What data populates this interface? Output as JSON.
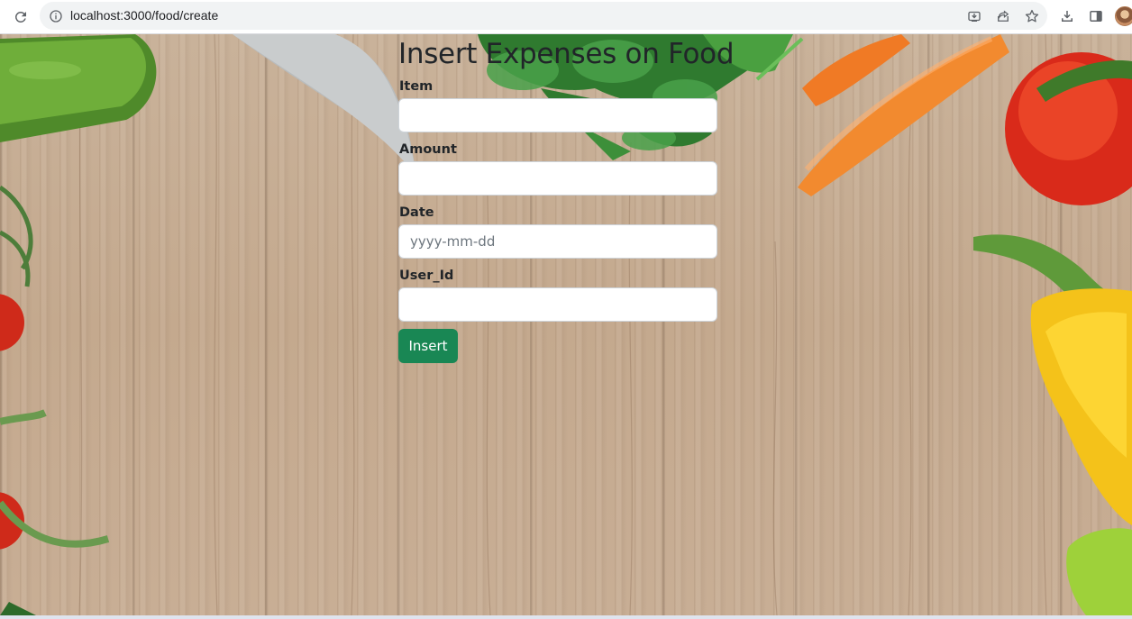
{
  "browser": {
    "url": "localhost:3000/food/create",
    "icons": {
      "reload": "reload-icon",
      "site_info": "info-icon",
      "install": "install-icon",
      "share": "share-icon",
      "bookmark": "star-icon",
      "downloads": "download-icon",
      "side_panel": "side-panel-icon",
      "profile": "avatar"
    }
  },
  "form": {
    "title": "Insert Expenses on Food",
    "fields": [
      {
        "label": "Item",
        "value": "",
        "placeholder": ""
      },
      {
        "label": "Amount",
        "value": "",
        "placeholder": ""
      },
      {
        "label": "Date",
        "value": "",
        "placeholder": "yyyy-mm-dd"
      },
      {
        "label": "User_Id",
        "value": "",
        "placeholder": ""
      }
    ],
    "submit_label": "Insert"
  },
  "colors": {
    "submit_button": "#198754",
    "wood_background": "#c7ad93",
    "omnibox": "#f1f3f4"
  }
}
